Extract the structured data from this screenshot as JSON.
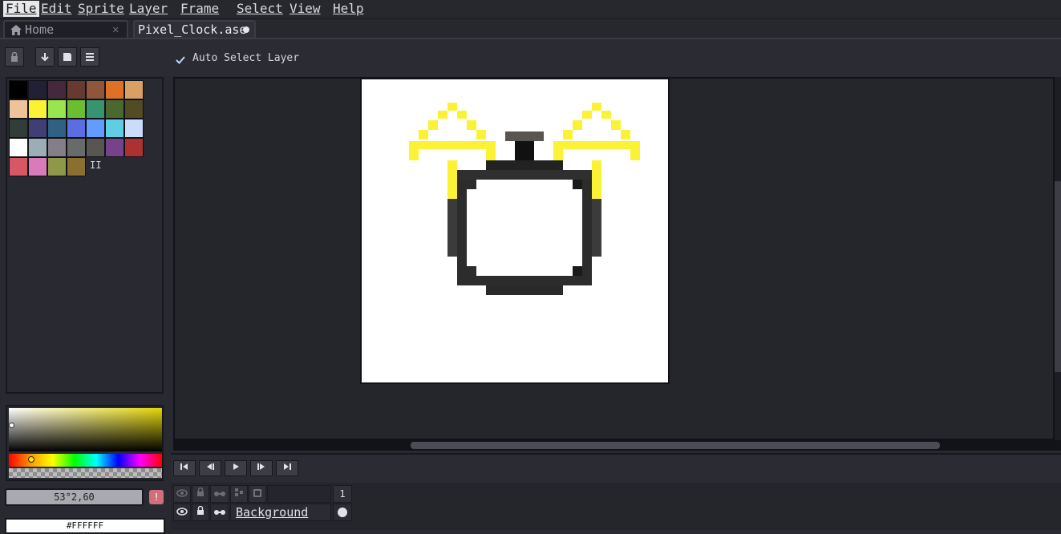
{
  "menu": {
    "items": [
      {
        "label": "File",
        "active": true
      },
      {
        "label": "Edit"
      },
      {
        "label": "Sprite"
      },
      {
        "label": "Layer"
      },
      {
        "label": "Frame"
      },
      {
        "label": "Select"
      },
      {
        "label": "View"
      },
      {
        "label": "Help"
      }
    ]
  },
  "tabs": {
    "home_label": "Home",
    "home_icon": "home-icon",
    "home_close": "✕",
    "file_label": "Pixel_Clock.ase",
    "file_modified_icon": "modified-dot-icon"
  },
  "context_bar": {
    "lock_icon": "lock-icon",
    "buttons": [
      "arrow-down-icon",
      "square-icon",
      "menu-icon"
    ],
    "auto_select_checked": true,
    "auto_select_label": "Auto Select Layer"
  },
  "palette": {
    "colors": [
      "#000000",
      "#222034",
      "#45283c",
      "#663931",
      "#8f563b",
      "#df7126",
      "#d9a066",
      "#eec39a",
      "#fbf236",
      "#99e550",
      "#6abe30",
      "#37946e",
      "#4b692f",
      "#524b24",
      "#323c39",
      "#3f3f74",
      "#306082",
      "#5b6ee1",
      "#639bff",
      "#5fcde4",
      "#cbdbfc",
      "#ffffff",
      "#9badb7",
      "#847e87",
      "#696a6a",
      "#595652",
      "#76428a",
      "#ac3232",
      "#d95763",
      "#d77bba",
      "#8f974a",
      "#8a6f30"
    ],
    "selected_index": 21,
    "more_indicator": "II"
  },
  "color_picker": {
    "value_text": "53°2,60",
    "warn_icon": "warning-icon",
    "hex_text": "#FFFFFF"
  },
  "canvas": {
    "file_name": "Pixel_Clock.ase"
  },
  "timeline": {
    "buttons": [
      "first-frame-icon",
      "prev-frame-icon",
      "play-icon",
      "next-frame-icon",
      "last-frame-icon"
    ],
    "header_icons": [
      "eye-icon",
      "lock-icon",
      "continuous-icon",
      "link-icon",
      "square-icon"
    ],
    "frame_number": "1",
    "layer_name": "Background",
    "cel_icon": "cel-dot-icon"
  }
}
